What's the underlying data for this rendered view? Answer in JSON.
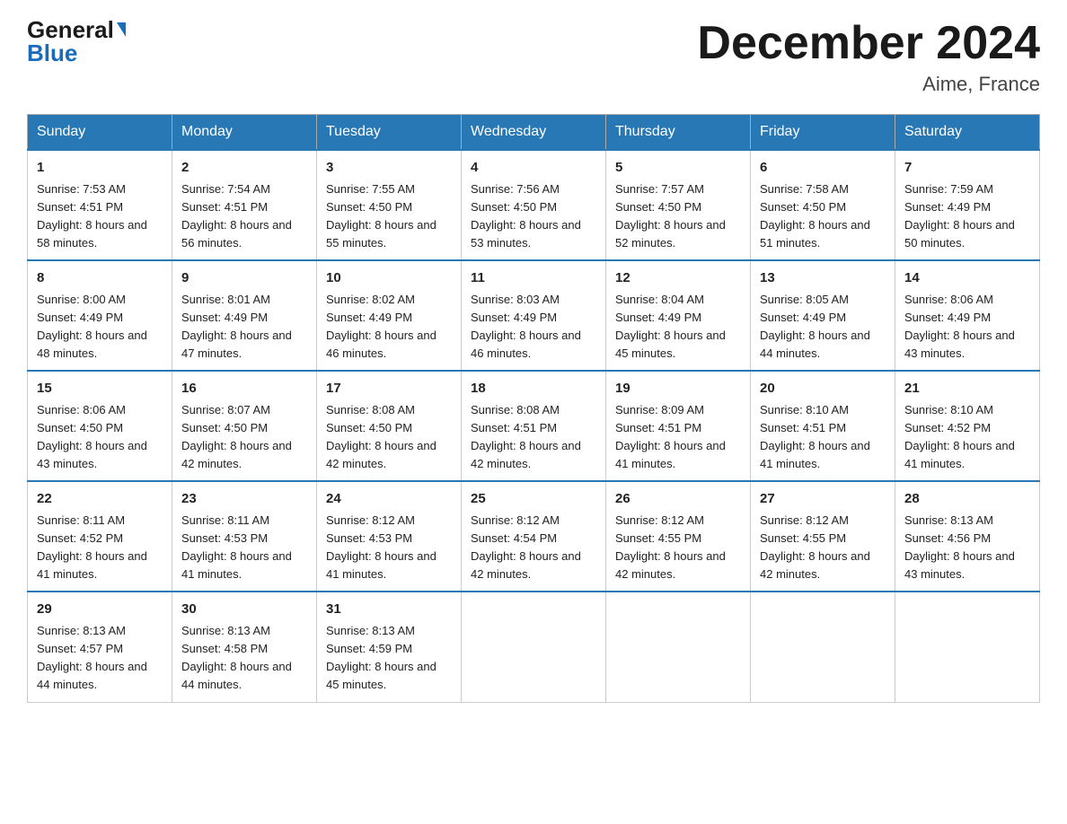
{
  "header": {
    "logo_general": "General",
    "logo_blue": "Blue",
    "month_title": "December 2024",
    "location": "Aime, France"
  },
  "weekdays": [
    "Sunday",
    "Monday",
    "Tuesday",
    "Wednesday",
    "Thursday",
    "Friday",
    "Saturday"
  ],
  "weeks": [
    [
      {
        "day": "1",
        "sunrise": "7:53 AM",
        "sunset": "4:51 PM",
        "daylight": "8 hours and 58 minutes."
      },
      {
        "day": "2",
        "sunrise": "7:54 AM",
        "sunset": "4:51 PM",
        "daylight": "8 hours and 56 minutes."
      },
      {
        "day": "3",
        "sunrise": "7:55 AM",
        "sunset": "4:50 PM",
        "daylight": "8 hours and 55 minutes."
      },
      {
        "day": "4",
        "sunrise": "7:56 AM",
        "sunset": "4:50 PM",
        "daylight": "8 hours and 53 minutes."
      },
      {
        "day": "5",
        "sunrise": "7:57 AM",
        "sunset": "4:50 PM",
        "daylight": "8 hours and 52 minutes."
      },
      {
        "day": "6",
        "sunrise": "7:58 AM",
        "sunset": "4:50 PM",
        "daylight": "8 hours and 51 minutes."
      },
      {
        "day": "7",
        "sunrise": "7:59 AM",
        "sunset": "4:49 PM",
        "daylight": "8 hours and 50 minutes."
      }
    ],
    [
      {
        "day": "8",
        "sunrise": "8:00 AM",
        "sunset": "4:49 PM",
        "daylight": "8 hours and 48 minutes."
      },
      {
        "day": "9",
        "sunrise": "8:01 AM",
        "sunset": "4:49 PM",
        "daylight": "8 hours and 47 minutes."
      },
      {
        "day": "10",
        "sunrise": "8:02 AM",
        "sunset": "4:49 PM",
        "daylight": "8 hours and 46 minutes."
      },
      {
        "day": "11",
        "sunrise": "8:03 AM",
        "sunset": "4:49 PM",
        "daylight": "8 hours and 46 minutes."
      },
      {
        "day": "12",
        "sunrise": "8:04 AM",
        "sunset": "4:49 PM",
        "daylight": "8 hours and 45 minutes."
      },
      {
        "day": "13",
        "sunrise": "8:05 AM",
        "sunset": "4:49 PM",
        "daylight": "8 hours and 44 minutes."
      },
      {
        "day": "14",
        "sunrise": "8:06 AM",
        "sunset": "4:49 PM",
        "daylight": "8 hours and 43 minutes."
      }
    ],
    [
      {
        "day": "15",
        "sunrise": "8:06 AM",
        "sunset": "4:50 PM",
        "daylight": "8 hours and 43 minutes."
      },
      {
        "day": "16",
        "sunrise": "8:07 AM",
        "sunset": "4:50 PM",
        "daylight": "8 hours and 42 minutes."
      },
      {
        "day": "17",
        "sunrise": "8:08 AM",
        "sunset": "4:50 PM",
        "daylight": "8 hours and 42 minutes."
      },
      {
        "day": "18",
        "sunrise": "8:08 AM",
        "sunset": "4:51 PM",
        "daylight": "8 hours and 42 minutes."
      },
      {
        "day": "19",
        "sunrise": "8:09 AM",
        "sunset": "4:51 PM",
        "daylight": "8 hours and 41 minutes."
      },
      {
        "day": "20",
        "sunrise": "8:10 AM",
        "sunset": "4:51 PM",
        "daylight": "8 hours and 41 minutes."
      },
      {
        "day": "21",
        "sunrise": "8:10 AM",
        "sunset": "4:52 PM",
        "daylight": "8 hours and 41 minutes."
      }
    ],
    [
      {
        "day": "22",
        "sunrise": "8:11 AM",
        "sunset": "4:52 PM",
        "daylight": "8 hours and 41 minutes."
      },
      {
        "day": "23",
        "sunrise": "8:11 AM",
        "sunset": "4:53 PM",
        "daylight": "8 hours and 41 minutes."
      },
      {
        "day": "24",
        "sunrise": "8:12 AM",
        "sunset": "4:53 PM",
        "daylight": "8 hours and 41 minutes."
      },
      {
        "day": "25",
        "sunrise": "8:12 AM",
        "sunset": "4:54 PM",
        "daylight": "8 hours and 42 minutes."
      },
      {
        "day": "26",
        "sunrise": "8:12 AM",
        "sunset": "4:55 PM",
        "daylight": "8 hours and 42 minutes."
      },
      {
        "day": "27",
        "sunrise": "8:12 AM",
        "sunset": "4:55 PM",
        "daylight": "8 hours and 42 minutes."
      },
      {
        "day": "28",
        "sunrise": "8:13 AM",
        "sunset": "4:56 PM",
        "daylight": "8 hours and 43 minutes."
      }
    ],
    [
      {
        "day": "29",
        "sunrise": "8:13 AM",
        "sunset": "4:57 PM",
        "daylight": "8 hours and 44 minutes."
      },
      {
        "day": "30",
        "sunrise": "8:13 AM",
        "sunset": "4:58 PM",
        "daylight": "8 hours and 44 minutes."
      },
      {
        "day": "31",
        "sunrise": "8:13 AM",
        "sunset": "4:59 PM",
        "daylight": "8 hours and 45 minutes."
      },
      null,
      null,
      null,
      null
    ]
  ]
}
